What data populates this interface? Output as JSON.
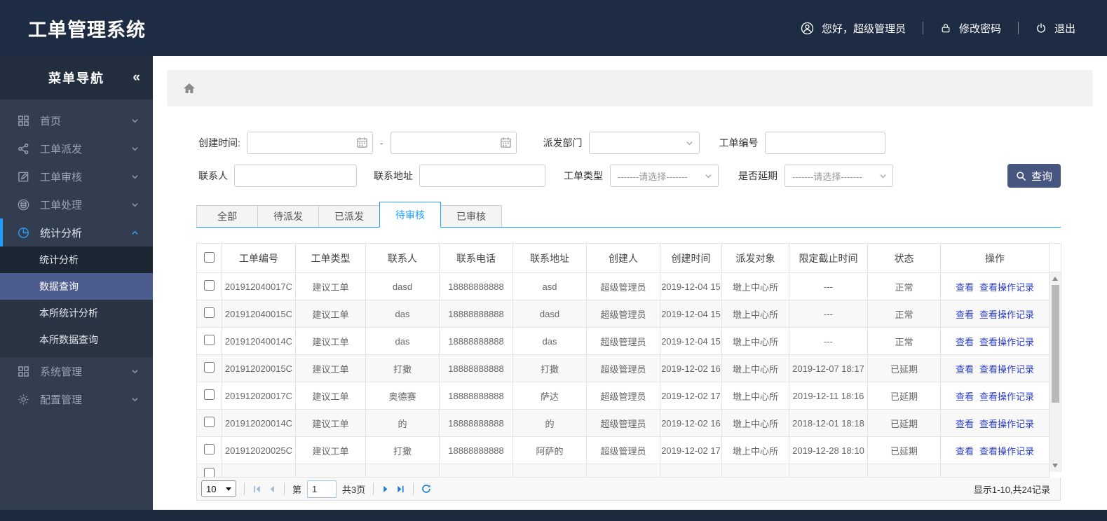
{
  "colors": {
    "header_bg": "#1d2b43",
    "sidebar_bg": "#323e4f",
    "accent_blue": "#1e9fff",
    "active_submenu_bg": "#4c5c8e",
    "status_normal_blue": "#2b3cd0",
    "status_delayed_red": "#e60012",
    "search_button_bg": "#475680"
  },
  "header": {
    "app_title": "工单管理系统",
    "greeting": "您好，超级管理员",
    "change_password": "修改密码",
    "logout": "退出"
  },
  "sidebar": {
    "title": "菜单导航",
    "collapse_icon": "«",
    "items": [
      {
        "label": "首页",
        "icon": "grid-icon",
        "expanded": false,
        "active": false
      },
      {
        "label": "工单派发",
        "icon": "share-icon",
        "expanded": false,
        "active": false
      },
      {
        "label": "工单审核",
        "icon": "edit-icon",
        "expanded": false,
        "active": false
      },
      {
        "label": "工单处理",
        "icon": "process-icon",
        "expanded": false,
        "active": false
      },
      {
        "label": "统计分析",
        "icon": "pie-chart-icon",
        "expanded": true,
        "active": true,
        "children": [
          {
            "label": "统计分析",
            "active": false
          },
          {
            "label": "数据查询",
            "active": true
          },
          {
            "label": "本所统计分析",
            "active": false
          },
          {
            "label": "本所数据查询",
            "active": false
          }
        ]
      },
      {
        "label": "系统管理",
        "icon": "grid-icon",
        "expanded": false,
        "active": false
      },
      {
        "label": "配置管理",
        "icon": "gear-icon",
        "expanded": false,
        "active": false
      }
    ]
  },
  "filters": {
    "create_time_label": "创建时间:",
    "date_separator": "-",
    "dispatch_dept_label": "派发部门",
    "order_no_label": "工单编号",
    "contact_label": "联系人",
    "address_label": "联系地址",
    "order_type_label": "工单类型",
    "order_type_placeholder": "-------请选择-------",
    "is_delayed_label": "是否延期",
    "is_delayed_placeholder": "-------请选择-------",
    "search_button": "查询"
  },
  "tabs": [
    {
      "label": "全部",
      "active": false
    },
    {
      "label": "待派发",
      "active": false
    },
    {
      "label": "已派发",
      "active": false
    },
    {
      "label": "待审核",
      "active": true
    },
    {
      "label": "已审核",
      "active": false
    }
  ],
  "table": {
    "columns": [
      "工单编号",
      "工单类型",
      "联系人",
      "联系电话",
      "联系地址",
      "创建人",
      "创建时间",
      "派发对象",
      "限定截止时间",
      "状态",
      "操作"
    ],
    "action_labels": [
      "查看",
      "查看操作记录"
    ],
    "rows": [
      {
        "order_no": "201912040017C",
        "order_type": "建议工单",
        "contact": "dasd",
        "phone": "18888888888",
        "address": "asd",
        "creator": "超级管理员",
        "create_time": "2019-12-04 15",
        "dispatch_target": "墩上中心所",
        "deadline": "---",
        "status": "正常",
        "status_type": "normal"
      },
      {
        "order_no": "201912040015C",
        "order_type": "建议工单",
        "contact": "das",
        "phone": "18888888888",
        "address": "dasd",
        "creator": "超级管理员",
        "create_time": "2019-12-04 15",
        "dispatch_target": "墩上中心所",
        "deadline": "---",
        "status": "正常",
        "status_type": "normal"
      },
      {
        "order_no": "201912040014C",
        "order_type": "建议工单",
        "contact": "das",
        "phone": "18888888888",
        "address": "das",
        "creator": "超级管理员",
        "create_time": "2019-12-04 15",
        "dispatch_target": "墩上中心所",
        "deadline": "---",
        "status": "正常",
        "status_type": "normal"
      },
      {
        "order_no": "201912020015C",
        "order_type": "建议工单",
        "contact": "打撒",
        "phone": "18888888888",
        "address": "打撒",
        "creator": "超级管理员",
        "create_time": "2019-12-02 16",
        "dispatch_target": "墩上中心所",
        "deadline": "2019-12-07 18:17",
        "status": "已延期",
        "status_type": "delayed"
      },
      {
        "order_no": "201912020017C",
        "order_type": "建议工单",
        "contact": "奥德赛",
        "phone": "18888888888",
        "address": "萨达",
        "creator": "超级管理员",
        "create_time": "2019-12-02 17",
        "dispatch_target": "墩上中心所",
        "deadline": "2019-12-11 18:16",
        "status": "已延期",
        "status_type": "delayed"
      },
      {
        "order_no": "201912020014C",
        "order_type": "建议工单",
        "contact": "的",
        "phone": "18888888888",
        "address": "的",
        "creator": "超级管理员",
        "create_time": "2019-12-02 16",
        "dispatch_target": "墩上中心所",
        "deadline": "2018-12-01 18:18",
        "status": "已延期",
        "status_type": "delayed"
      },
      {
        "order_no": "201912020025C",
        "order_type": "建议工单",
        "contact": "打撒",
        "phone": "18888888888",
        "address": "阿萨的",
        "creator": "超级管理员",
        "create_time": "2019-12-02 17",
        "dispatch_target": "墩上中心所",
        "deadline": "2019-12-28 18:10",
        "status": "已延期",
        "status_type": "delayed"
      }
    ]
  },
  "pagination": {
    "page_size": "10",
    "page_prefix": "第",
    "current_page": "1",
    "total_pages": "共3页",
    "summary": "显示1-10,共24记录"
  }
}
